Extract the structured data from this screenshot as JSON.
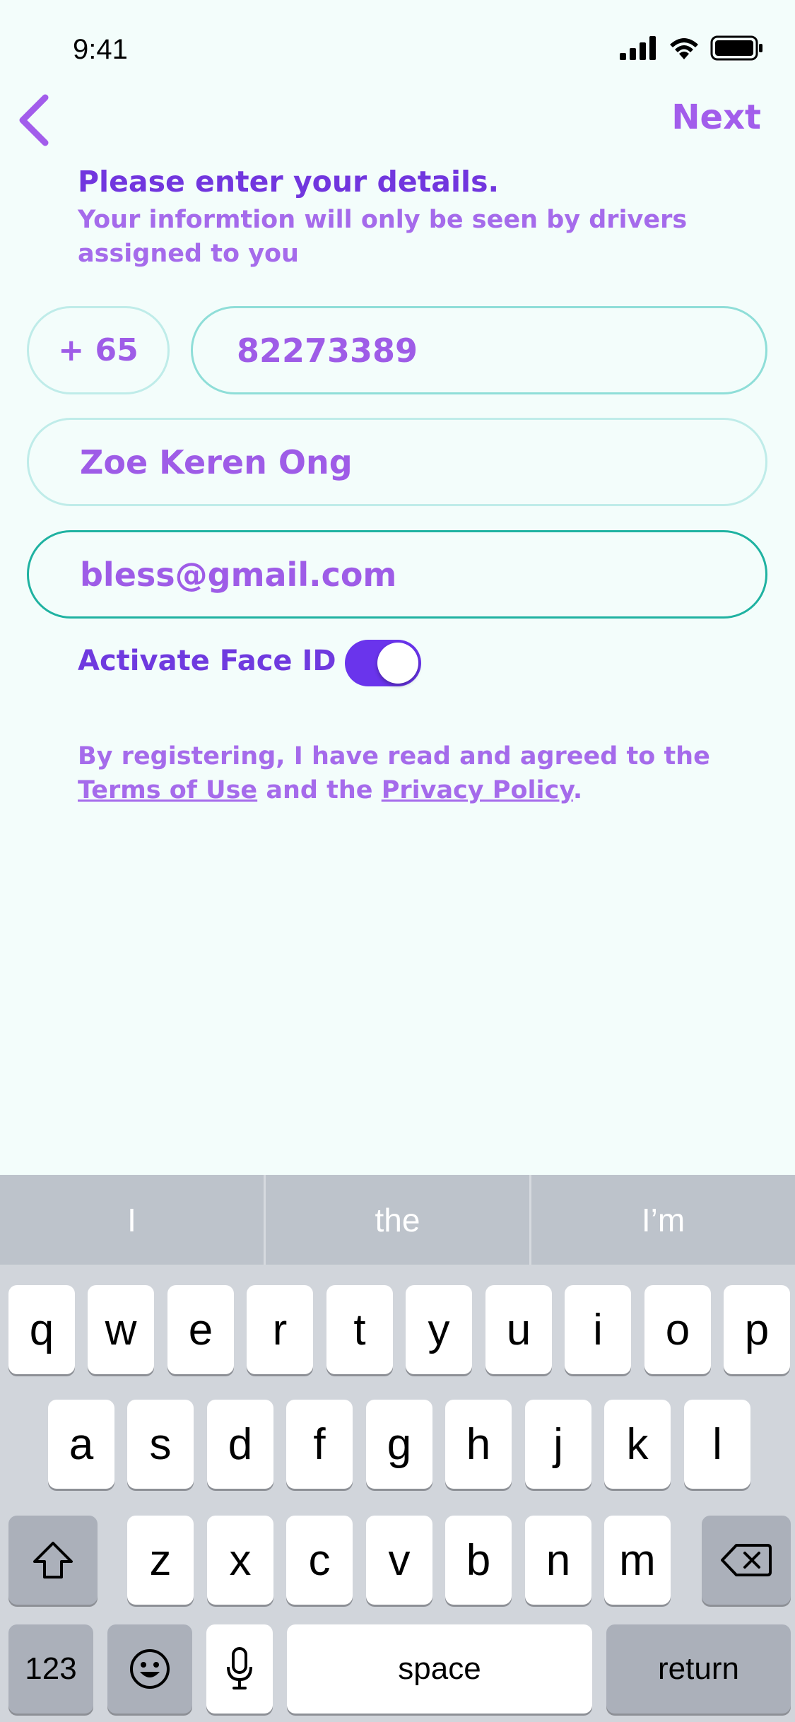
{
  "status_bar": {
    "time": "9:41"
  },
  "nav": {
    "next_label": "Next"
  },
  "form": {
    "title": "Please enter your details.",
    "subtitle": "Your informtion will only be seen by drivers assigned to you",
    "country_code": "+ 65",
    "phone_value": "82273389",
    "name_value": "Zoe Keren Ong",
    "email_value": "bless@gmail.com",
    "faceid_label": "Activate Face ID",
    "faceid_on": true,
    "terms_prefix": "By registering, I have read and agreed to the",
    "terms_link": "Terms of Use",
    "terms_middle": "and the",
    "privacy_link": "Privacy Policy",
    "terms_suffix": "."
  },
  "colors": {
    "accent": "#6A34EC",
    "field_border": "#BFECE9",
    "active_border": "#1FB2A1",
    "background": "#F3FDFB"
  },
  "keyboard": {
    "suggestions": [
      "I",
      "the",
      "I’m"
    ],
    "row1": [
      "q",
      "w",
      "e",
      "r",
      "t",
      "y",
      "u",
      "i",
      "o",
      "p"
    ],
    "row2": [
      "a",
      "s",
      "d",
      "f",
      "g",
      "h",
      "j",
      "k",
      "l"
    ],
    "row3": [
      "z",
      "x",
      "c",
      "v",
      "b",
      "n",
      "m"
    ],
    "numbers_label": "123",
    "space_label": "space",
    "return_label": "return",
    "icons": [
      "shift-icon",
      "backspace-icon",
      "emoji-icon",
      "microphone-icon"
    ]
  }
}
